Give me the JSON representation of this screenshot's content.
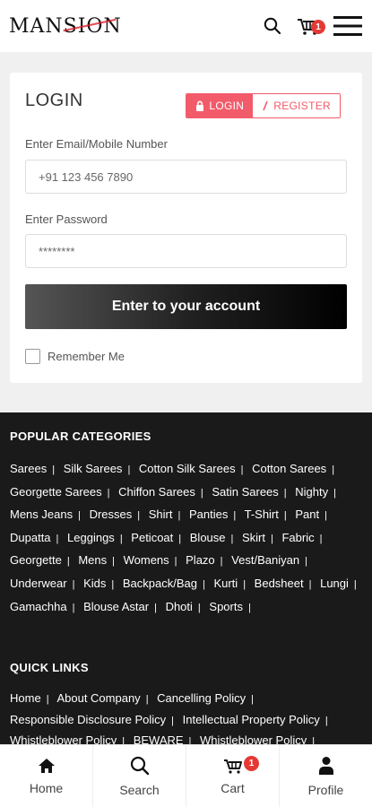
{
  "header": {
    "logo_text": "MANSION",
    "cart_count": "1"
  },
  "login": {
    "title": "LOGIN",
    "tab_login": "LOGIN",
    "tab_register": "REGISTER",
    "email_label": "Enter Email/Mobile Number",
    "email_placeholder": "+91 123 456 7890",
    "password_label": "Enter Password",
    "password_placeholder": "********",
    "submit_label": "Enter to your account",
    "remember_label": "Remember Me"
  },
  "footer": {
    "categories_title": "POPULAR CATEGORIES",
    "categories": [
      "Sarees",
      "Silk Sarees",
      "Cotton Silk Sarees",
      "Cotton Sarees",
      "Georgette Sarees",
      "Chiffon Sarees",
      "Satin Sarees",
      "Nighty",
      "Mens Jeans",
      "Dresses",
      "Shirt",
      "Panties",
      "T-Shirt",
      "Pant",
      "Dupatta",
      "Leggings",
      "Peticoat",
      "Blouse",
      "Skirt",
      "Fabric",
      "Georgette",
      "Mens",
      "Womens",
      "Plazo",
      "Vest/Baniyan",
      "Underwear",
      "Kids",
      "Backpack/Bag",
      "Kurti",
      "Bedsheet",
      "Lungi",
      "Gamachha",
      "Blouse Astar",
      "Dhoti",
      "Sports"
    ],
    "quick_links_title": "QUICK LINKS",
    "quick_links": [
      "Home",
      "About Company",
      "Cancelling Policy",
      "Responsible Disclosure Policy",
      "Intellectual Property Policy",
      "Whistleblower Policy",
      "BEWARE",
      "Whistleblower Policy"
    ]
  },
  "bottom_nav": {
    "items": [
      {
        "label": "Home",
        "icon": "home-icon"
      },
      {
        "label": "Search",
        "icon": "search-icon"
      },
      {
        "label": "Cart",
        "icon": "cart-icon"
      },
      {
        "label": "Profile",
        "icon": "profile-icon"
      }
    ],
    "cart_count": "1"
  },
  "colors": {
    "accent": "#f25b6a",
    "badge": "#e53935",
    "footer_bg": "#1a1a1a"
  }
}
